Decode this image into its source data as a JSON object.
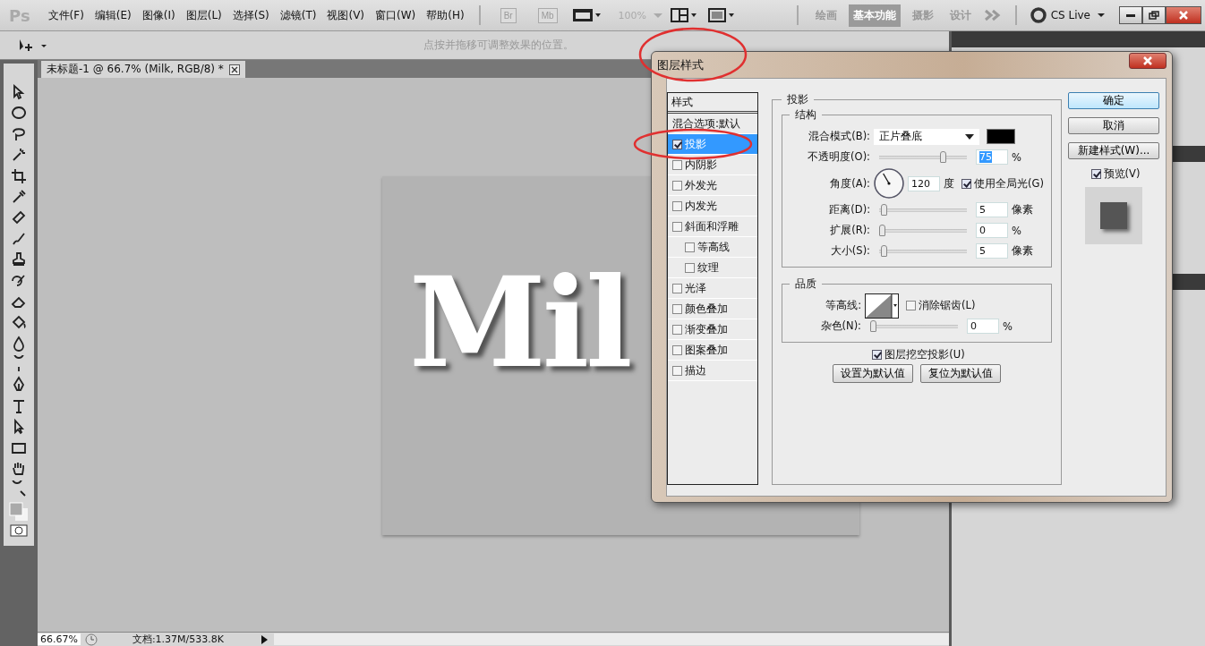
{
  "app_logo": "Ps",
  "menu": [
    "文件(F)",
    "编辑(E)",
    "图像(I)",
    "图层(L)",
    "选择(S)",
    "滤镜(T)",
    "视图(V)",
    "窗口(W)",
    "帮助(H)"
  ],
  "app_bar": {
    "bridge": "Br",
    "mini_bridge": "Mb",
    "zoom": "100%"
  },
  "workspaces": [
    {
      "label": "绘画",
      "selected": false
    },
    {
      "label": "基本功能",
      "selected": true
    },
    {
      "label": "摄影",
      "selected": false
    },
    {
      "label": "设计",
      "selected": false
    }
  ],
  "cs_live": "CS Live",
  "options_bar": {
    "hint": "点按并拖移可调整效果的位置。"
  },
  "document": {
    "tab": "未标题-1 @ 66.7% (Milk, RGB/8) *",
    "canvas_text": "Mil"
  },
  "status_bar": {
    "zoom": "66.67%",
    "doc_info": "文档:1.37M/533.8K"
  },
  "dialog": {
    "title": "图层样式",
    "styles_header": "样式",
    "styles": [
      {
        "label": "混合选项:默认",
        "kind": "header",
        "selected": false
      },
      {
        "label": "投影",
        "kind": "check",
        "checked": true,
        "selected": true
      },
      {
        "label": "内阴影",
        "kind": "check",
        "checked": false,
        "selected": false
      },
      {
        "label": "外发光",
        "kind": "check",
        "checked": false,
        "selected": false
      },
      {
        "label": "内发光",
        "kind": "check",
        "checked": false,
        "selected": false
      },
      {
        "label": "斜面和浮雕",
        "kind": "check",
        "checked": false,
        "selected": false
      },
      {
        "label": "等高线",
        "kind": "sub",
        "checked": false,
        "selected": false
      },
      {
        "label": "纹理",
        "kind": "sub",
        "checked": false,
        "selected": false
      },
      {
        "label": "光泽",
        "kind": "check",
        "checked": false,
        "selected": false
      },
      {
        "label": "颜色叠加",
        "kind": "check",
        "checked": false,
        "selected": false
      },
      {
        "label": "渐变叠加",
        "kind": "check",
        "checked": false,
        "selected": false
      },
      {
        "label": "图案叠加",
        "kind": "check",
        "checked": false,
        "selected": false
      },
      {
        "label": "描边",
        "kind": "check",
        "checked": false,
        "selected": false
      }
    ],
    "section": "投影",
    "structure": {
      "title": "结构",
      "blend_label": "混合模式(B):",
      "blend_value": "正片叠底",
      "color": "#000000",
      "opacity": {
        "label": "不透明度(O):",
        "level": 0.75,
        "value": "75",
        "unit": "%"
      },
      "angle": {
        "label": "角度(A):",
        "value": "120",
        "unit": "度",
        "global_light": {
          "label": "使用全局光(G)",
          "checked": true
        }
      },
      "sliders": [
        {
          "label": "距离(D):",
          "level": 0.02,
          "value": "5",
          "unit": "像素"
        },
        {
          "label": "扩展(R):",
          "level": 0,
          "value": "0",
          "unit": "%"
        },
        {
          "label": "大小(S):",
          "level": 0.02,
          "value": "5",
          "unit": "像素"
        }
      ]
    },
    "quality": {
      "title": "品质",
      "contour_label": "等高线:",
      "anti_alias": {
        "label": "消除锯齿(L)",
        "checked": false
      },
      "noise": {
        "label": "杂色(N):",
        "level": 0,
        "value": "0",
        "unit": "%"
      }
    },
    "knockout": {
      "label": "图层挖空投影(U)",
      "checked": true
    },
    "default_buttons": [
      "设置为默认值",
      "复位为默认值"
    ],
    "buttons": [
      "确定",
      "取消",
      "新建样式(W)..."
    ],
    "preview": {
      "label": "预览(V)",
      "checked": true
    }
  }
}
